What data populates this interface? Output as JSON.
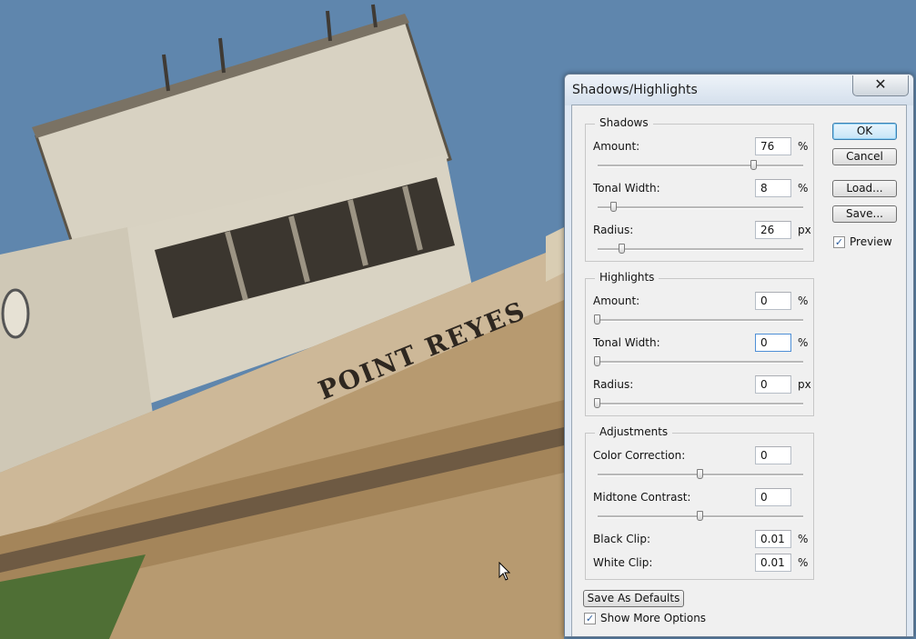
{
  "photo": {
    "hull_lettering": "POINT REYES"
  },
  "dialog": {
    "title": "Shadows/Highlights",
    "close_glyph": "✕",
    "buttons": {
      "ok": "OK",
      "cancel": "Cancel",
      "load": "Load...",
      "save": "Save..."
    },
    "preview": {
      "label": "Preview",
      "checked": true
    },
    "save_defaults": "Save As Defaults",
    "show_more": {
      "label": "Show More Options",
      "checked": true
    },
    "check_glyph": "✓",
    "shadows": {
      "legend": "Shadows",
      "amount": {
        "label": "Amount:",
        "value": "76",
        "unit": "%",
        "level": 0.76
      },
      "tonal_width": {
        "label": "Tonal Width:",
        "value": "8",
        "unit": "%",
        "level": 0.08
      },
      "radius": {
        "label": "Radius:",
        "value": "26",
        "unit": "px",
        "level": 0.12
      }
    },
    "highlights": {
      "legend": "Highlights",
      "amount": {
        "label": "Amount:",
        "value": "0",
        "unit": "%",
        "level": 0
      },
      "tonal_width": {
        "label": "Tonal Width:",
        "value": "0",
        "unit": "%",
        "level": 0
      },
      "radius": {
        "label": "Radius:",
        "value": "0",
        "unit": "px",
        "level": 0
      }
    },
    "adjustments": {
      "legend": "Adjustments",
      "color_correction": {
        "label": "Color Correction:",
        "value": "0",
        "level": 0.5
      },
      "midtone_contrast": {
        "label": "Midtone Contrast:",
        "value": "0",
        "level": 0.5
      },
      "black_clip": {
        "label": "Black Clip:",
        "value": "0.01",
        "unit": "%"
      },
      "white_clip": {
        "label": "White Clip:",
        "value": "0.01",
        "unit": "%"
      }
    }
  },
  "colors": {
    "sky": "#5f86ad",
    "dialog_chrome": "#dfe8f3",
    "client": "#f0f0f0",
    "default_button": "#3c7fb1"
  }
}
